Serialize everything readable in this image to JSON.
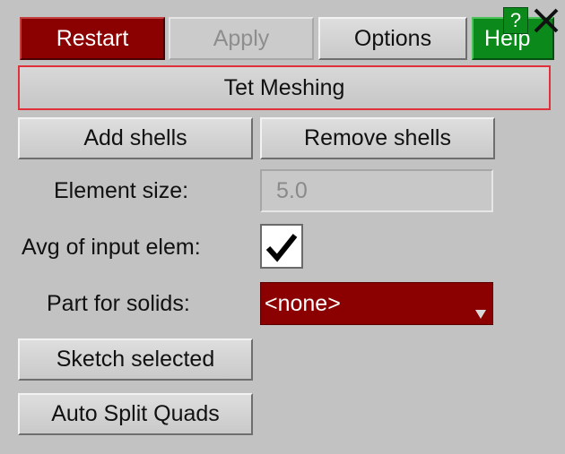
{
  "toolbar": {
    "restart_label": "Restart",
    "apply_label": "Apply",
    "options_label": "Options",
    "help_label": "Help",
    "help_glyph": "?",
    "close_glyph": "×"
  },
  "panel_title": "Tet Meshing",
  "shell_buttons": {
    "add_label": "Add shells",
    "remove_label": "Remove shells"
  },
  "element_size": {
    "label": "Element size:",
    "value": "5.0"
  },
  "avg_input_elem": {
    "label": "Avg of input elem:",
    "checked": true
  },
  "part_for_solids": {
    "label": "Part for solids:",
    "value": "<none>"
  },
  "actions": {
    "sketch_label": "Sketch selected",
    "auto_split_label": "Auto Split Quads"
  },
  "colors": {
    "background": "#c2c2c2",
    "red_button": "#8b0000",
    "green_button": "#0b8a1b",
    "title_border": "#e0303a"
  }
}
